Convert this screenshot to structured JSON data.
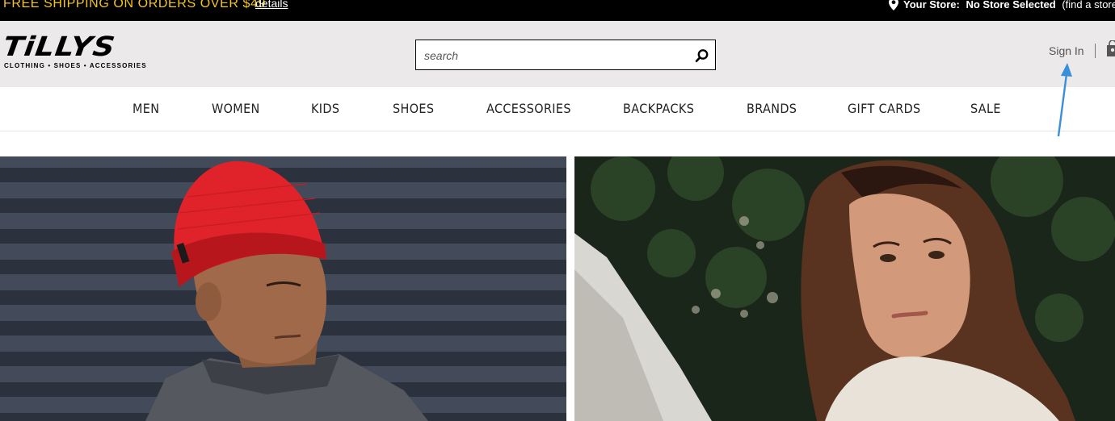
{
  "promo": {
    "text": "FREE SHIPPING ON ORDERS OVER $49",
    "link": "details"
  },
  "store": {
    "label": "Your Store:",
    "value": "No Store Selected",
    "find": "(find a store)"
  },
  "logo": {
    "name": "TiLLYS",
    "tagline": "CLOTHING • SHOES • ACCESSORIES"
  },
  "search": {
    "placeholder": "search",
    "value": ""
  },
  "account": {
    "sign_in": "Sign In"
  },
  "nav": {
    "items": [
      {
        "label": "MEN"
      },
      {
        "label": "WOMEN"
      },
      {
        "label": "KIDS"
      },
      {
        "label": "SHOES"
      },
      {
        "label": "ACCESSORIES"
      },
      {
        "label": "BACKPACKS"
      },
      {
        "label": "BRANDS"
      },
      {
        "label": "GIFT CARDS"
      },
      {
        "label": "SALE"
      }
    ]
  },
  "colors": {
    "promo_bg": "#000000",
    "promo_text": "#f5c518",
    "header_bg": "#ebe9ea",
    "annotation_arrow": "#3a8fd8"
  },
  "icons": [
    "location-pin-icon",
    "search-icon",
    "shopping-bag-icon"
  ]
}
